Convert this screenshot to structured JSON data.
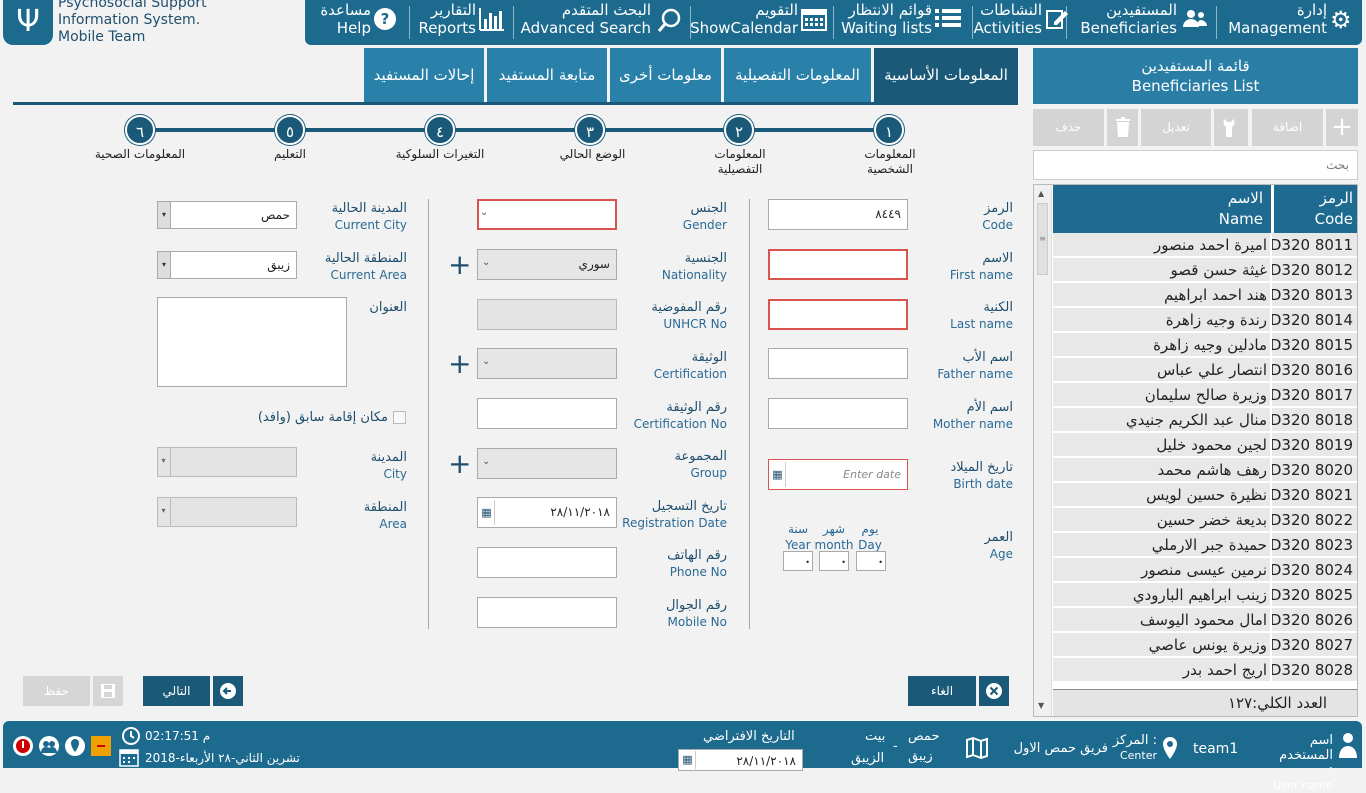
{
  "app": {
    "logo_line1": "Psychosocial Support",
    "logo_line2": "Information System.",
    "logo_line3": "Mobile Team"
  },
  "nav": [
    {
      "ar": "إدارة",
      "en": "Management",
      "icon": "gear-icon"
    },
    {
      "ar": "المستفيدين",
      "en": "Beneficiaries",
      "icon": "users-icon"
    },
    {
      "ar": "النشاطات",
      "en": "Activities",
      "icon": "edit-icon"
    },
    {
      "ar": "قوائم الانتظار",
      "en": "Waiting lists",
      "icon": "list-icon"
    },
    {
      "ar": "التقويم",
      "en": "ShowCalendar",
      "icon": "calendar-icon"
    },
    {
      "ar": "البحث المتقدم",
      "en": "Advanced Search",
      "icon": "search-icon"
    },
    {
      "ar": "التقارير",
      "en": "Reports",
      "icon": "chart-icon"
    },
    {
      "ar": "مساعدة",
      "en": "Help",
      "icon": "help-icon"
    }
  ],
  "tabs": [
    "المعلومات الأساسية",
    "المعلومات التفصيلية",
    "معلومات أخرى",
    "متابعة المستفيد",
    "إحالات المستفيد"
  ],
  "steps": [
    {
      "num": "١",
      "label1": "المعلومات",
      "label2": "الشخصية"
    },
    {
      "num": "٢",
      "label1": "المعلومات",
      "label2": "التفصيلية"
    },
    {
      "num": "٣",
      "label1": "الوضع الحالي",
      "label2": ""
    },
    {
      "num": "٤",
      "label1": "التغيرات السلوكية",
      "label2": ""
    },
    {
      "num": "٥",
      "label1": "التعليم",
      "label2": ""
    },
    {
      "num": "٦",
      "label1": "المعلومات الصحية",
      "label2": ""
    }
  ],
  "form": {
    "code": {
      "ar": "الرمز",
      "en": "Code",
      "value": "٨٤٤٩"
    },
    "first_name": {
      "ar": "الاسم",
      "en": "First name",
      "value": ""
    },
    "last_name": {
      "ar": "الكنية",
      "en": "Last name",
      "value": ""
    },
    "father_name": {
      "ar": "اسم الأب",
      "en": "Father name",
      "value": ""
    },
    "mother_name": {
      "ar": "اسم الأم",
      "en": "Mother name",
      "value": ""
    },
    "birth_date": {
      "ar": "تاريخ الميلاد",
      "en": "Birth date",
      "placeholder": "Enter date"
    },
    "age": {
      "ar": "العمر",
      "en": "Age",
      "day_ar": "يوم",
      "day_en": "Day",
      "month_ar": "شهر",
      "month_en": "month",
      "year_ar": "سنة",
      "year_en": "Year"
    },
    "gender": {
      "ar": "الجنس",
      "en": "Gender",
      "value": ""
    },
    "nationality": {
      "ar": "الجنسية",
      "en": "Nationality",
      "value": "سوري"
    },
    "unhcr": {
      "ar": "رقم المفوضية",
      "en": "UNHCR No",
      "value": ""
    },
    "certification": {
      "ar": "الوثيقة",
      "en": "Certification",
      "value": ""
    },
    "cert_no": {
      "ar": "رقم الوثيقة",
      "en": "Certification No",
      "value": ""
    },
    "group": {
      "ar": "المجموعة",
      "en": "Group",
      "value": ""
    },
    "reg_date": {
      "ar": "تاريخ التسجيل",
      "en": "Registration Date",
      "value": "٢٨/١١/٢٠١٨"
    },
    "phone": {
      "ar": "رقم الهاتف",
      "en": "Phone No",
      "value": ""
    },
    "mobile": {
      "ar": "رقم الجوال",
      "en": "Mobile No",
      "value": ""
    },
    "current_city": {
      "ar": "المدينة الحالية",
      "en": "Current City",
      "value": "حمص"
    },
    "current_area": {
      "ar": "المنطقة الحالية",
      "en": "Current Area",
      "value": "زيبق"
    },
    "address": {
      "ar": "العنوان"
    },
    "prev_residence": {
      "ar": "مكان إقامة سابق (وافد)"
    },
    "city": {
      "ar": "المدينة",
      "en": "City",
      "value": ""
    },
    "area": {
      "ar": "المنطقة",
      "en": "Area",
      "value": ""
    }
  },
  "buttons": {
    "cancel": "الغاء",
    "next": "التالي",
    "save": "حفظ"
  },
  "side": {
    "title_ar": "قائمة المستفيدين",
    "title_en": "Beneficiaries List",
    "add": "اضافة",
    "edit": "تعديل",
    "delete": "حذف",
    "search_placeholder": "بحث",
    "col_code_ar": "الرمز",
    "col_code_en": "Code",
    "col_name_ar": "الاسم",
    "col_name_en": "Name",
    "rows": [
      {
        "code": "D320 8011",
        "name": "اميرة احمد منصور"
      },
      {
        "code": "D320 8012",
        "name": "غيثة حسن قصو"
      },
      {
        "code": "D320 8013",
        "name": "هند احمد ابراهيم"
      },
      {
        "code": "D320 8014",
        "name": "رندة وجيه زاهرة"
      },
      {
        "code": "D320 8015",
        "name": "مادلين وجيه زاهرة"
      },
      {
        "code": "D320 8016",
        "name": "انتصار علي عباس"
      },
      {
        "code": "D320 8017",
        "name": "وزيرة صالح سليمان"
      },
      {
        "code": "D320 8018",
        "name": "منال عبد الكريم جنيدي"
      },
      {
        "code": "D320 8019",
        "name": "لجين محمود خليل"
      },
      {
        "code": "D320 8020",
        "name": "رهف هاشم محمد"
      },
      {
        "code": "D320 8021",
        "name": "نظيرة حسين لويس"
      },
      {
        "code": "D320 8022",
        "name": "بديعة خضر حسين"
      },
      {
        "code": "D320 8023",
        "name": "حميدة جبر الارملي"
      },
      {
        "code": "D320 8024",
        "name": "نرمين عيسى منصور"
      },
      {
        "code": "D320 8025",
        "name": "زينب ابراهيم البارودي"
      },
      {
        "code": "D320 8026",
        "name": "امال محمود اليوسف"
      },
      {
        "code": "D320 8027",
        "name": "وزيرة يونس عاصي"
      },
      {
        "code": "D320 8028",
        "name": "اريج احمد بدر"
      }
    ],
    "total": "العدد الكلي:١٢٧"
  },
  "status": {
    "user_label_ar": "اسم المستخدم :",
    "user_label_en": "User name",
    "user": "team1",
    "center_ar": "المركز :",
    "center_en": "Center",
    "center": "فريق حمص الاول",
    "city": "حمص",
    "area_line1": "بيت",
    "area_line2": "زيبق",
    "area_sep": "-",
    "area_line3": "الزيبق",
    "default_date_label": "التاريخ الافتراضي",
    "default_date": "٢٨/١١/٢٠١٨",
    "time": "م 02:17:51",
    "date": "تشرين الثاني-٢٨ الأربعاء-2018"
  }
}
